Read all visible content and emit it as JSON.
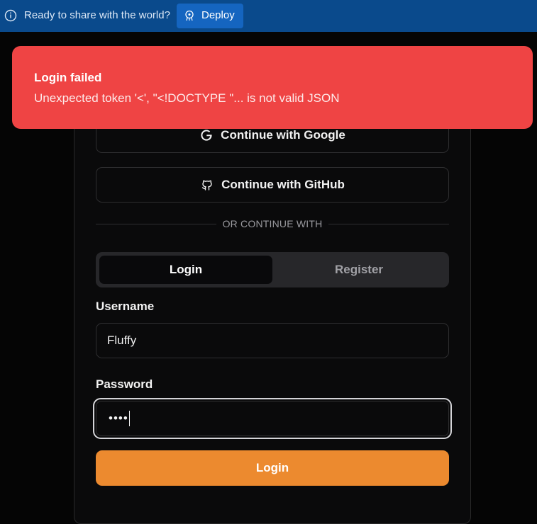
{
  "banner": {
    "text": "Ready to share with the world?",
    "deploy_label": "Deploy",
    "bg_color": "#0a4a8c",
    "info_icon": "info-icon",
    "deploy_icon": "rocket-icon"
  },
  "oauth": {
    "google_label": "Continue with Google",
    "github_label": "Continue with GitHub"
  },
  "divider_text": "OR CONTINUE WITH",
  "tabs": [
    {
      "label": "Login",
      "active": true
    },
    {
      "label": "Register",
      "active": false
    }
  ],
  "form": {
    "username_label": "Username",
    "username_value": "Fluffy",
    "password_label": "Password",
    "password_masked": "••••",
    "submit_label": "Login",
    "accent_color": "#ec8a2f"
  },
  "toast": {
    "title": "Login failed",
    "message": "Unexpected token '<', \"<!DOCTYPE \"... is not valid JSON",
    "color": "#ef4444"
  }
}
